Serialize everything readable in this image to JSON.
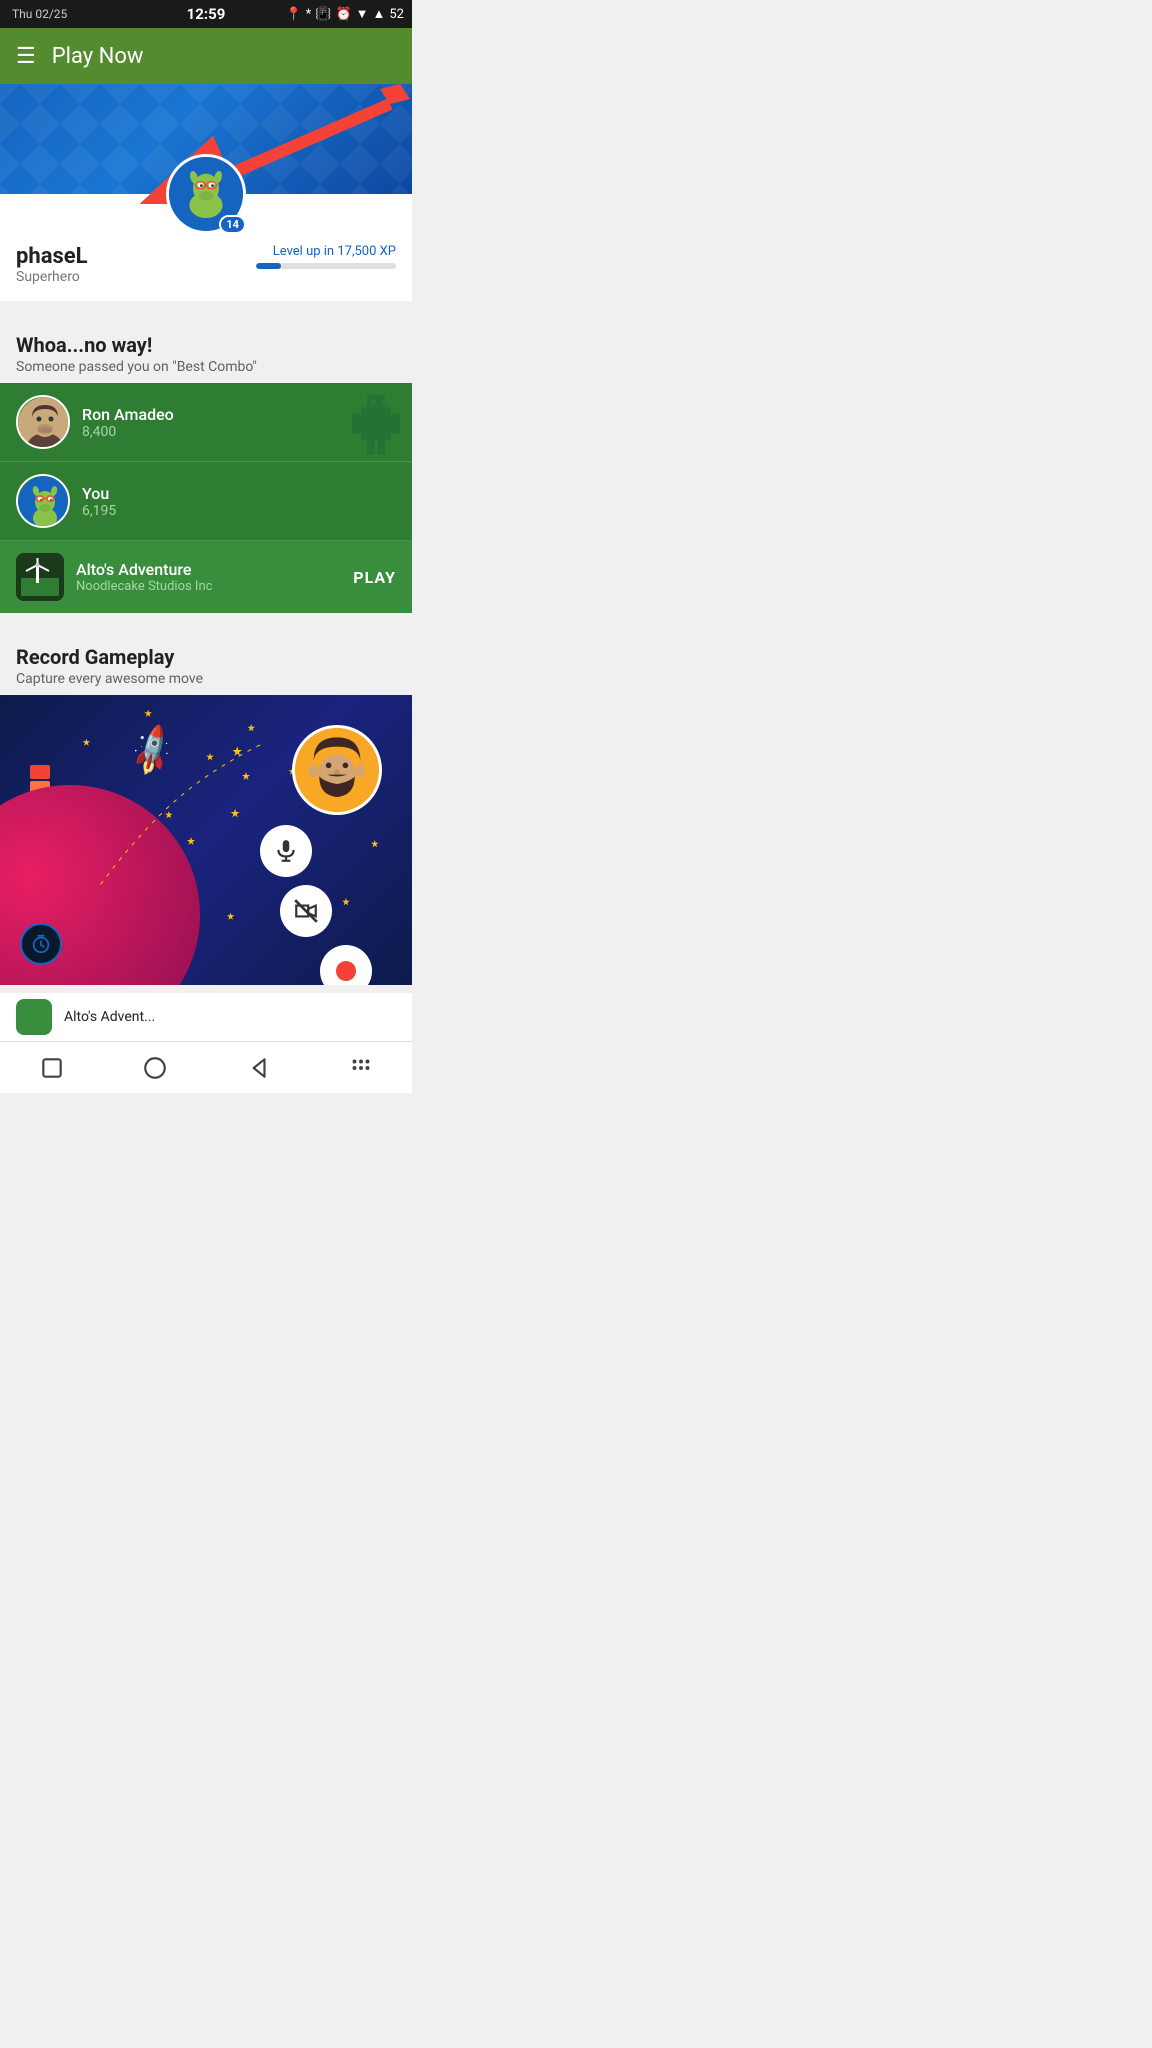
{
  "statusBar": {
    "date": "Thu 02/25",
    "time": "12:59",
    "battery": "52"
  },
  "toolbar": {
    "title": "Play Now",
    "menuIcon": "☰"
  },
  "profile": {
    "username": "phaseL",
    "rank": "Superhero",
    "levelUpText": "Level up in 17,500 XP",
    "level": "14",
    "xpPercent": "18"
  },
  "competition": {
    "sectionTitle": "Whoa...no way!",
    "sectionSubtitle": "Someone passed you on \"Best Combo\"",
    "players": [
      {
        "name": "Ron Amadeo",
        "score": "8,400"
      },
      {
        "name": "You",
        "score": "6,195"
      }
    ],
    "game": {
      "name": "Alto's Adventure",
      "developer": "Noodlecake Studios Inc",
      "playLabel": "PLAY"
    }
  },
  "recordSection": {
    "sectionTitle": "Record Gameplay",
    "sectionSubtitle": "Capture every awesome move"
  },
  "bottomGame": {
    "name": "Alto's Advent..."
  },
  "navBar": {
    "squareIcon": "□",
    "circleIcon": "○",
    "backIcon": "◁",
    "dotsIcon": "⋮⋮"
  }
}
